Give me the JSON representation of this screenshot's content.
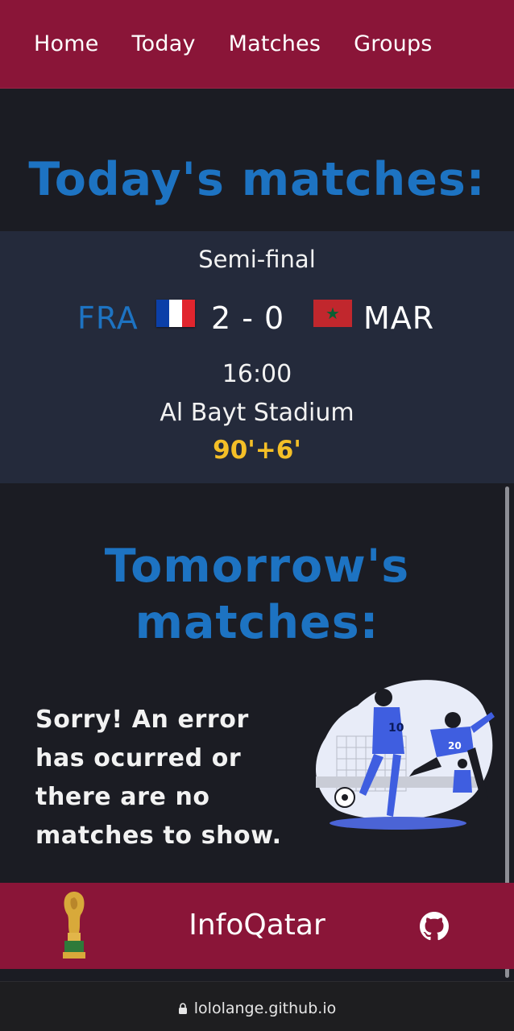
{
  "nav": {
    "items": [
      {
        "label": "Home"
      },
      {
        "label": "Today"
      },
      {
        "label": "Matches"
      },
      {
        "label": "Groups"
      }
    ]
  },
  "today": {
    "title": "Today's matches:",
    "match": {
      "stage": "Semi-final",
      "home_team": "FRA",
      "home_flag": "france-flag",
      "score": "2 - 0",
      "away_team": "MAR",
      "away_flag": "morocco-flag",
      "time": "16:00",
      "stadium": "Al Bayt Stadium",
      "minute": "90'+6'"
    }
  },
  "tomorrow": {
    "title_line1": "Tomorrow's",
    "title_line2": "matches:",
    "error_message": "Sorry! An error has ocurred or there are no matches to show."
  },
  "footer": {
    "brand": "InfoQatar",
    "logo_icon": "world-cup-trophy-icon",
    "github_icon": "github-icon"
  },
  "browser": {
    "url": "lololange.github.io"
  },
  "colors": {
    "primary": "#8a1538",
    "accent": "#1d73c2",
    "minute": "#f4bf27",
    "background": "#1b1c23",
    "card": "#242a3b"
  }
}
